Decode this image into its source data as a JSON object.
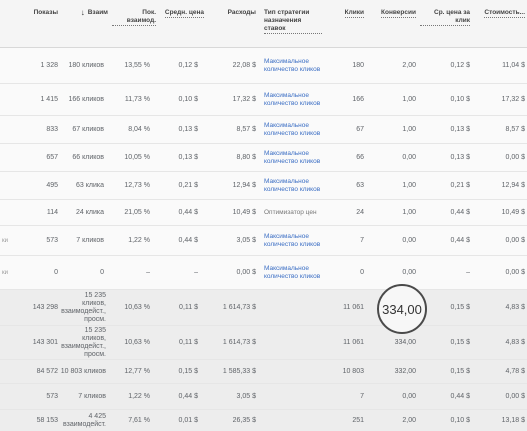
{
  "header": {
    "impressions": "Показы",
    "interactions": "Взаим",
    "interaction_rate": "Пок. взаимод.",
    "avg_cost": "Средн. цена",
    "cost": "Расходы",
    "strategy_type": "Тип стратегии назначения ставок",
    "clicks": "Клики",
    "conversions": "Конверсии",
    "avg_cpc": "Ср. цена за клик",
    "cost_per_conv": "Стоимость..."
  },
  "rows": [
    {
      "impr": "1 328",
      "inter": "180 кликов",
      "rate": "13,55 %",
      "avg": "0,12 $",
      "cost": "22,08 $",
      "strat": "Максимальное количество кликов",
      "clicks": "180",
      "conv": "2,00",
      "cpc": "0,12 $",
      "cpconv": "11,04 $"
    },
    {
      "impr": "1 415",
      "inter": "166 кликов",
      "rate": "11,73 %",
      "avg": "0,10 $",
      "cost": "17,32 $",
      "strat": "Максимальное количество кликов",
      "clicks": "166",
      "conv": "1,00",
      "cpc": "0,10 $",
      "cpconv": "17,32 $"
    },
    {
      "impr": "833",
      "inter": "67 кликов",
      "rate": "8,04 %",
      "avg": "0,13 $",
      "cost": "8,57 $",
      "strat": "Максимальное количество кликов",
      "clicks": "67",
      "conv": "1,00",
      "cpc": "0,13 $",
      "cpconv": "8,57 $"
    },
    {
      "impr": "657",
      "inter": "66 кликов",
      "rate": "10,05 %",
      "avg": "0,13 $",
      "cost": "8,80 $",
      "strat": "Максимальное количество кликов",
      "clicks": "66",
      "conv": "0,00",
      "cpc": "0,13 $",
      "cpconv": "0,00 $"
    },
    {
      "impr": "495",
      "inter": "63 клика",
      "rate": "12,73 %",
      "avg": "0,21 $",
      "cost": "12,94 $",
      "strat": "Максимальное количество кликов",
      "clicks": "63",
      "conv": "1,00",
      "cpc": "0,21 $",
      "cpconv": "12,94 $"
    },
    {
      "impr": "114",
      "inter": "24 клика",
      "rate": "21,05 %",
      "avg": "0,44 $",
      "cost": "10,49 $",
      "strat": "Оптимизатор цен",
      "clicks": "24",
      "conv": "1,00",
      "cpc": "0,44 $",
      "cpconv": "10,49 $"
    },
    {
      "impr": "573",
      "inter": "7 кликов",
      "rate": "1,22 %",
      "avg": "0,44 $",
      "cost": "3,05 $",
      "strat": "Максимальное количество кликов",
      "clicks": "7",
      "conv": "0,00",
      "cpc": "0,44 $",
      "cpconv": "0,00 $"
    },
    {
      "impr": "0",
      "inter": "0",
      "rate": "–",
      "avg": "–",
      "cost": "0,00 $",
      "strat": "Максимальное количество кликов",
      "clicks": "0",
      "conv": "0,00",
      "cpc": "–",
      "cpconv": "0,00 $"
    }
  ],
  "totals": [
    {
      "impr": "143 298",
      "inter": "15 235 кликов, взаимодейст., просм.",
      "rate": "10,63 %",
      "avg": "0,11 $",
      "cost": "1 614,73 $",
      "clicks": "11 061",
      "conv": "334,00",
      "cpc": "0,15 $",
      "cpconv": "4,83 $"
    },
    {
      "impr": "143 301",
      "inter": "15 235 кликов, взаимодейст., просм.",
      "rate": "10,63 %",
      "avg": "0,11 $",
      "cost": "1 614,73 $",
      "clicks": "11 061",
      "conv": "334,00",
      "cpc": "0,15 $",
      "cpconv": "4,83 $"
    },
    {
      "impr": "84 572",
      "inter": "10 803 кликов",
      "rate": "12,77 %",
      "avg": "0,15 $",
      "cost": "1 585,33 $",
      "clicks": "10 803",
      "conv": "332,00",
      "cpc": "0,15 $",
      "cpconv": "4,78 $"
    },
    {
      "impr": "573",
      "inter": "7 кликов",
      "rate": "1,22 %",
      "avg": "0,44 $",
      "cost": "3,05 $",
      "clicks": "7",
      "conv": "0,00",
      "cpc": "0,44 $",
      "cpconv": "0,00 $"
    },
    {
      "impr": "58 153",
      "inter": "4 425 взаимодейст.",
      "rate": "7,61 %",
      "avg": "0,01 $",
      "cost": "26,35 $",
      "clicks": "251",
      "conv": "2,00",
      "cpc": "0,10 $",
      "cpconv": "13,18 $"
    }
  ],
  "left_fragments": {
    "row7": "ки",
    "row8": "ки"
  },
  "highlight": "334,00"
}
